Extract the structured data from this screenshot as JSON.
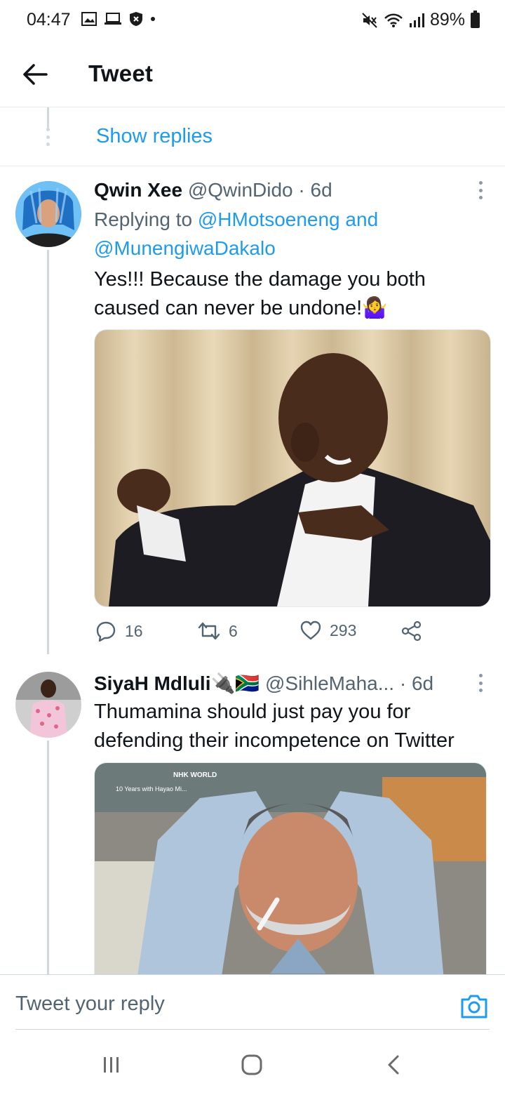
{
  "status_bar": {
    "time": "04:47",
    "battery": "89%"
  },
  "header": {
    "title": "Tweet"
  },
  "show_replies": "Show replies",
  "tweets": [
    {
      "name": "Qwin Xee",
      "handle": "@QwinDido",
      "time": "· 6d",
      "replying_prefix": "Replying to ",
      "mention1": "@HMotsoeneng",
      "conjunction": " and",
      "mention2": "@MunengiwaDakalo",
      "text": "Yes!!! Because the damage you both caused can never be undone!",
      "emoji": "🤷‍♀️",
      "replies": "16",
      "retweets": "6",
      "likes": "293"
    },
    {
      "name": "SiyaH Mdluli",
      "name_emoji": "🔌🇿🇦",
      "handle": "@SihleMaha...",
      "time": "· 6d",
      "text": "Thumamina should just pay you for defending their incompetence on Twitter",
      "media_caption": "NHK WORLD",
      "media_subcaption": "10 Years with Hayao Mi..."
    }
  ],
  "reply_bar": {
    "placeholder": "Tweet your reply"
  }
}
